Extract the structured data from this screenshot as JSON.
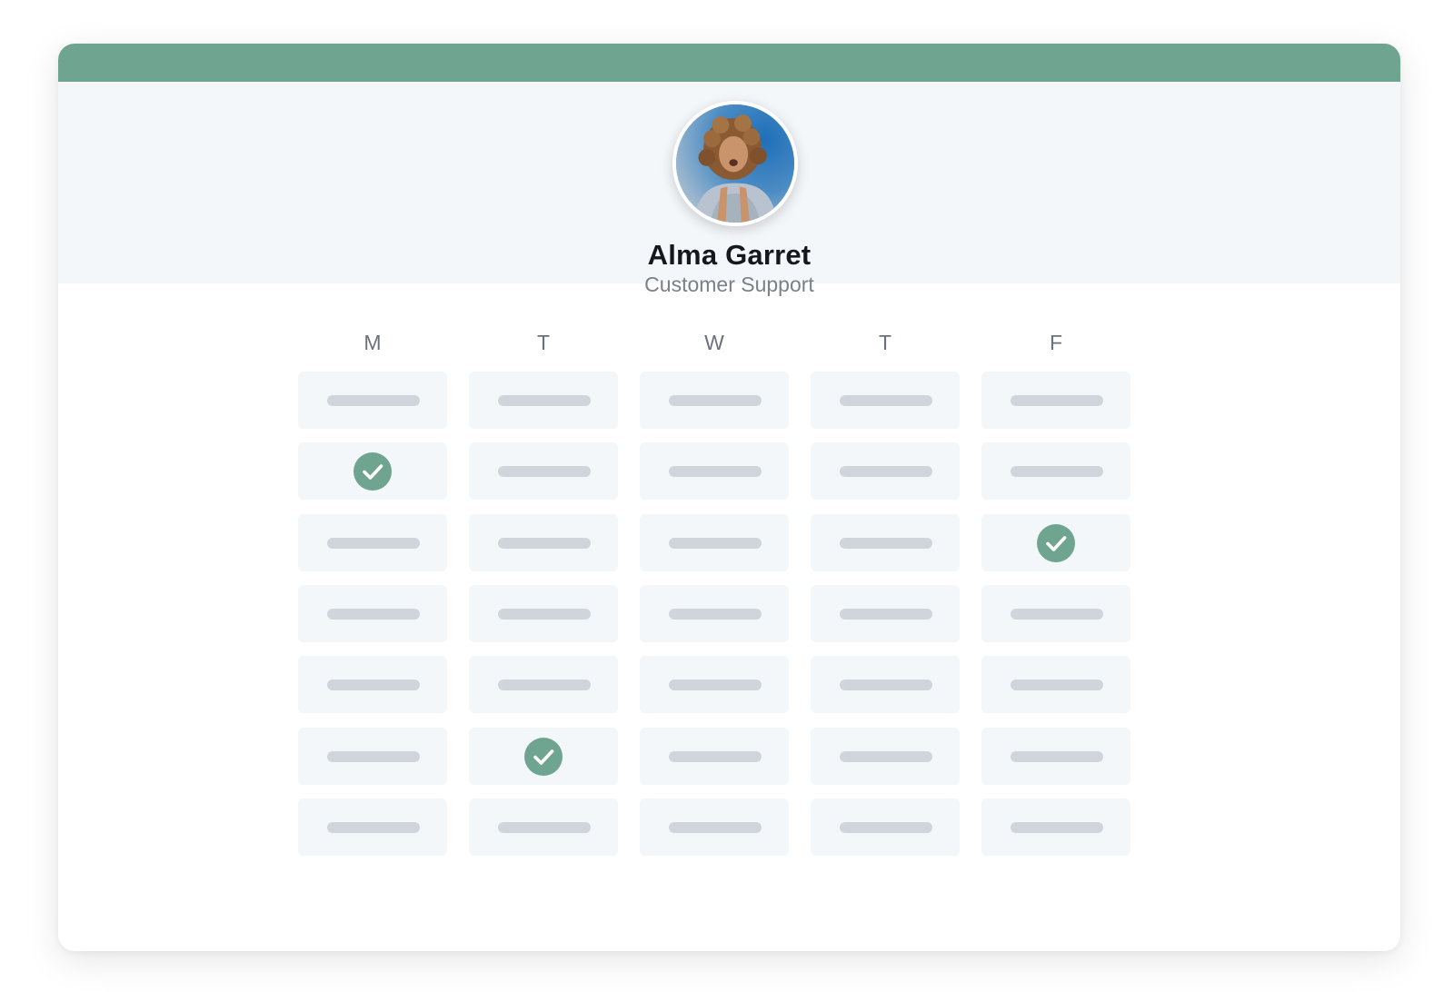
{
  "profile": {
    "name": "Alma Garret",
    "role": "Customer Support"
  },
  "schedule": {
    "days": [
      "M",
      "T",
      "W",
      "T",
      "F"
    ],
    "rows": 7,
    "checked": [
      {
        "day": 0,
        "row": 1
      },
      {
        "day": 4,
        "row": 2
      },
      {
        "day": 1,
        "row": 5
      }
    ]
  },
  "colors": {
    "accent": "#6fa491",
    "slot_bg": "#f4f7fa",
    "placeholder_bar": "#cfd5db"
  },
  "icons": {
    "check": "check-icon",
    "avatar": "avatar"
  }
}
